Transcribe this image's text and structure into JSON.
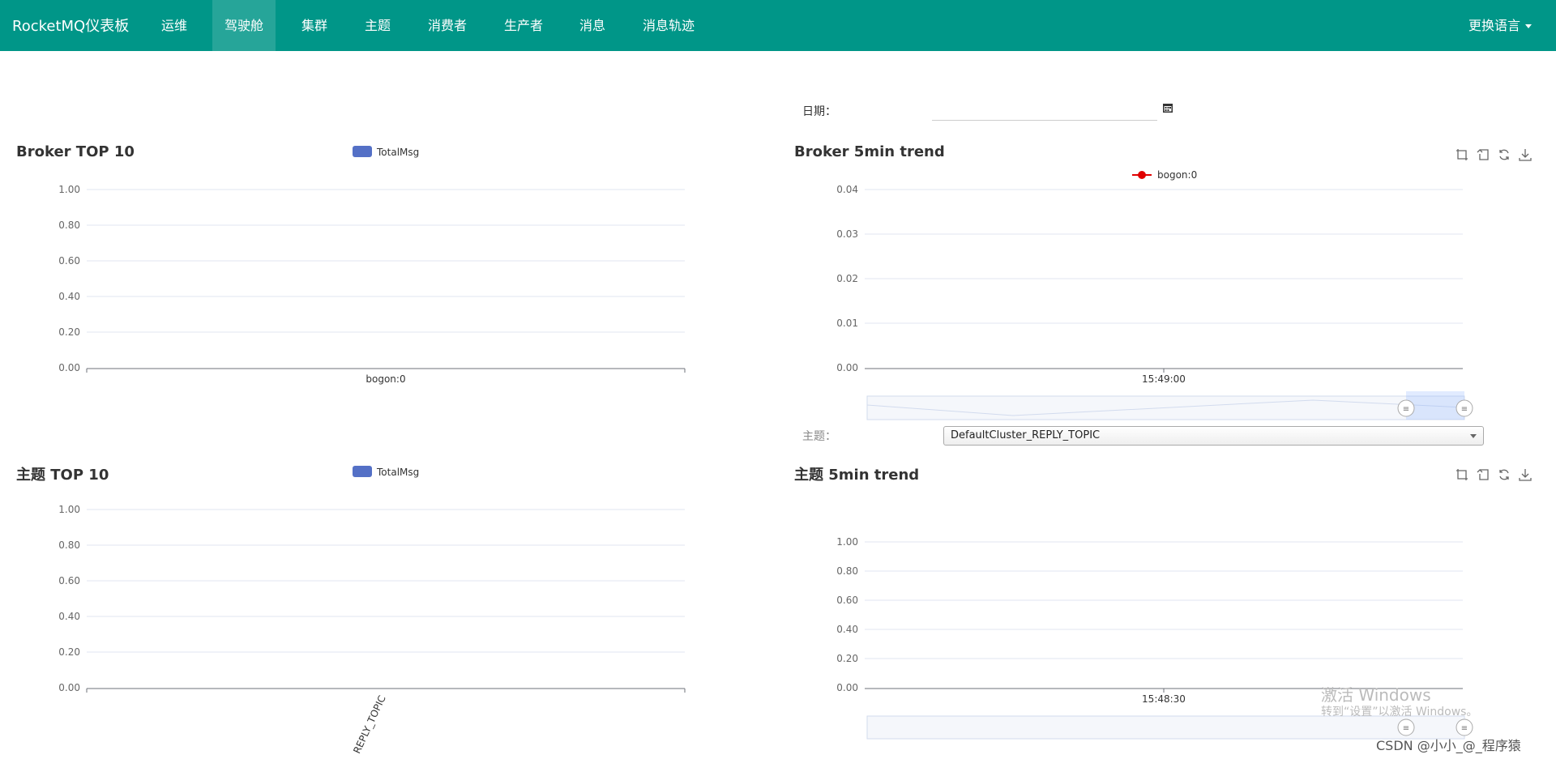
{
  "navbar": {
    "brand": "RocketMQ仪表板",
    "items": [
      {
        "label": "运维"
      },
      {
        "label": "驾驶舱"
      },
      {
        "label": "集群"
      },
      {
        "label": "主题"
      },
      {
        "label": "消费者"
      },
      {
        "label": "生产者"
      },
      {
        "label": "消息"
      },
      {
        "label": "消息轨迹"
      }
    ],
    "language": "更换语言"
  },
  "filters": {
    "date_label": "日期：",
    "topic_label": "主题：",
    "topic_value": "DefaultCluster_REPLY_TOPIC"
  },
  "colors": {
    "nav": "#009688",
    "bar_legend": "#5470c6",
    "line": "#e00000"
  },
  "chart_data": [
    {
      "id": "broker_top10",
      "type": "bar",
      "title": "Broker TOP 10",
      "categories": [
        "bogon:0"
      ],
      "series": [
        {
          "name": "TotalMsg",
          "values": [
            0
          ]
        }
      ],
      "yticks": [
        "1.00",
        "0.80",
        "0.60",
        "0.40",
        "0.20",
        "0.00"
      ],
      "ylim": [
        0,
        1
      ],
      "legend": "top-center"
    },
    {
      "id": "broker_trend",
      "type": "line",
      "title": "Broker 5min trend",
      "x": [
        "15:49:00"
      ],
      "series": [
        {
          "name": "bogon:0",
          "values": [
            0
          ]
        }
      ],
      "yticks": [
        "0.04",
        "0.03",
        "0.02",
        "0.01",
        "0.00"
      ],
      "ylim": [
        0,
        0.04
      ],
      "legend": "top-center"
    },
    {
      "id": "topic_top10",
      "type": "bar",
      "title": "主题 TOP 10",
      "categories": [
        "REPLY_TOPIC"
      ],
      "series": [
        {
          "name": "TotalMsg",
          "values": [
            0
          ]
        }
      ],
      "yticks": [
        "1.00",
        "0.80",
        "0.60",
        "0.40",
        "0.20",
        "0.00"
      ],
      "ylim": [
        0,
        1
      ],
      "legend": "top-center"
    },
    {
      "id": "topic_trend",
      "type": "line",
      "title": "主题 5min trend",
      "x": [
        "15:48:30"
      ],
      "series": [],
      "yticks": [
        "1.00",
        "0.80",
        "0.60",
        "0.40",
        "0.20",
        "0.00"
      ],
      "ylim": [
        0,
        1
      ]
    }
  ],
  "watermark": {
    "line1": "激活 Windows",
    "line2": "转到“设置”以激活 Windows。",
    "csdn": "CSDN @小小_@_程序猿"
  }
}
